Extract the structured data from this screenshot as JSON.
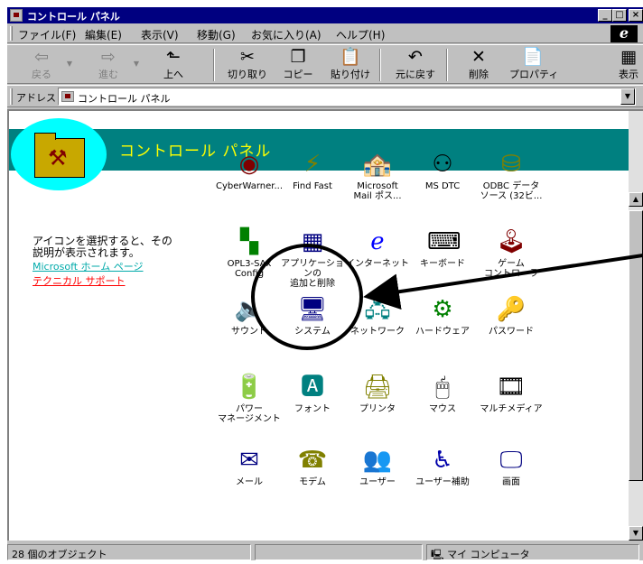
{
  "window": {
    "title": "コントロール パネル",
    "buttons": [
      "_",
      "□",
      "×"
    ]
  },
  "menubar": {
    "items": [
      "ファイル(F)",
      "編集(E)",
      "表示(V)",
      "移動(G)",
      "お気に入り(A)",
      "ヘルプ(H)"
    ],
    "logo": "e"
  },
  "toolbar": {
    "back": "戻る",
    "forward": "進む",
    "up": "上へ",
    "cut": "切り取り",
    "copy": "コピー",
    "paste": "貼り付け",
    "undo": "元に戻す",
    "delete": "削除",
    "properties": "プロパティ",
    "view": "表示"
  },
  "address": {
    "label": "アドレス",
    "value": "コントロール パネル"
  },
  "banner": {
    "title": "コントロール パネル"
  },
  "left_panel": {
    "description": "アイコンを選択すると、その\n説明が表示されます。",
    "link_home": "Microsoft ホーム ページ",
    "link_support": "テクニカル サポート"
  },
  "icons": [
    {
      "label": "CyberWarner...",
      "icon": "eye-icon"
    },
    {
      "label": "Find Fast",
      "icon": "find-fast-icon"
    },
    {
      "label": "Microsoft\nMail ポス...",
      "icon": "mail-postoffice-icon"
    },
    {
      "label": "MS DTC",
      "icon": "dtc-icon"
    },
    {
      "label": "ODBC データ\nソース (32ビ...",
      "icon": "odbc-icon"
    },
    {
      "label": "OPL3-SAx\nConfig",
      "icon": "sound-config-icon"
    },
    {
      "label": "アプリケーションの\n追加と削除",
      "icon": "add-remove-programs-icon"
    },
    {
      "label": "インターネット",
      "icon": "internet-icon"
    },
    {
      "label": "キーボード",
      "icon": "keyboard-icon"
    },
    {
      "label": "ゲーム\nコントローラ",
      "icon": "game-controller-icon"
    },
    {
      "label": "サウンド",
      "icon": "sound-icon"
    },
    {
      "label": "システム",
      "icon": "system-icon"
    },
    {
      "label": "ネットワーク",
      "icon": "network-icon"
    },
    {
      "label": "ハードウェア",
      "icon": "hardware-icon"
    },
    {
      "label": "パスワード",
      "icon": "password-icon"
    },
    {
      "label": "パワー\nマネージメント",
      "icon": "power-icon"
    },
    {
      "label": "フォント",
      "icon": "font-icon"
    },
    {
      "label": "プリンタ",
      "icon": "printer-icon"
    },
    {
      "label": "マウス",
      "icon": "mouse-icon"
    },
    {
      "label": "マルチメディア",
      "icon": "multimedia-icon"
    },
    {
      "label": "メール",
      "icon": "mail-icon"
    },
    {
      "label": "モデム",
      "icon": "modem-icon"
    },
    {
      "label": "ユーザー",
      "icon": "users-icon"
    },
    {
      "label": "ユーザー補助",
      "icon": "accessibility-icon"
    },
    {
      "label": "画面",
      "icon": "display-icon"
    }
  ],
  "status": {
    "count": "28 個のオブジェクト",
    "zone": "マイ コンピュータ"
  },
  "colors": {
    "title_bar": "#000080",
    "banner": "#008080",
    "banner_title": "#ffff00",
    "link_home": "#00aaaa",
    "link_support": "#ff0000",
    "annotation": "#000000"
  }
}
